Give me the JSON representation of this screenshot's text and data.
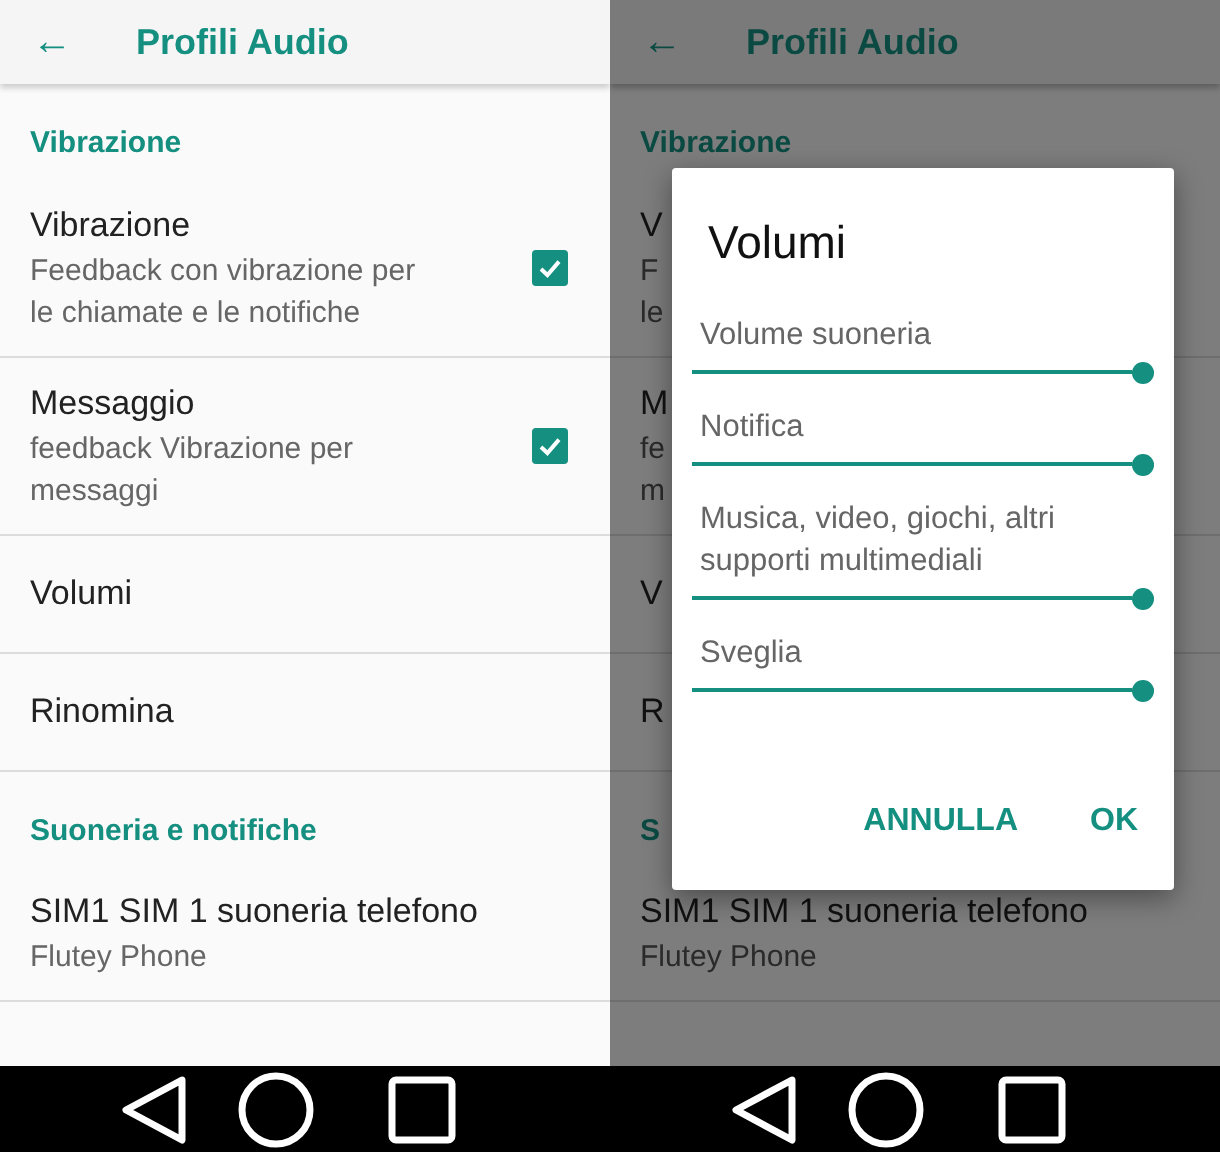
{
  "screens": [
    {
      "dimmed": false,
      "title": "Profili Audio",
      "back": "←",
      "sections": [
        {
          "header": "Vibrazione",
          "items": [
            {
              "title": "Vibrazione",
              "subtitle_lines": [
                "Feedback con vibrazione per",
                "le chiamate e le notifiche"
              ],
              "checked": true
            },
            {
              "title": "Messaggio",
              "subtitle_lines": [
                "feedback Vibrazione per",
                "messaggi"
              ],
              "checked": true
            },
            {
              "title": "Volumi"
            },
            {
              "title": "Rinomina"
            }
          ]
        },
        {
          "header": "Suoneria e notifiche",
          "items": [
            {
              "title": "SIM1 SIM 1 suoneria telefono",
              "subtitle_lines": [
                "Flutey Phone"
              ]
            }
          ]
        }
      ]
    },
    {
      "dimmed": true,
      "title": "Profili Audio",
      "back": "←",
      "sections": [
        {
          "header": "Vibrazione",
          "items": [
            {
              "title": "V",
              "subtitle_lines": [
                "F",
                "le"
              ]
            },
            {
              "title": "M",
              "subtitle_lines": [
                "fe",
                "m"
              ]
            },
            {
              "title": "V"
            },
            {
              "title": "R"
            }
          ]
        },
        {
          "header": "S",
          "items": [
            {
              "title": "SIM1 SIM 1 suoneria telefono",
              "subtitle_lines": [
                "Flutey Phone"
              ]
            }
          ]
        }
      ],
      "dialog": {
        "title": "Volumi",
        "sliders": [
          {
            "label": "Volume suoneria",
            "level": 1
          },
          {
            "label": "Notifica",
            "level": 1
          },
          {
            "label": "Musica, video, giochi, altri supporti multimediali",
            "level": 1
          },
          {
            "label": "Sveglia",
            "level": 1
          }
        ],
        "buttons": [
          "ANNULLA",
          "OK"
        ]
      }
    }
  ]
}
